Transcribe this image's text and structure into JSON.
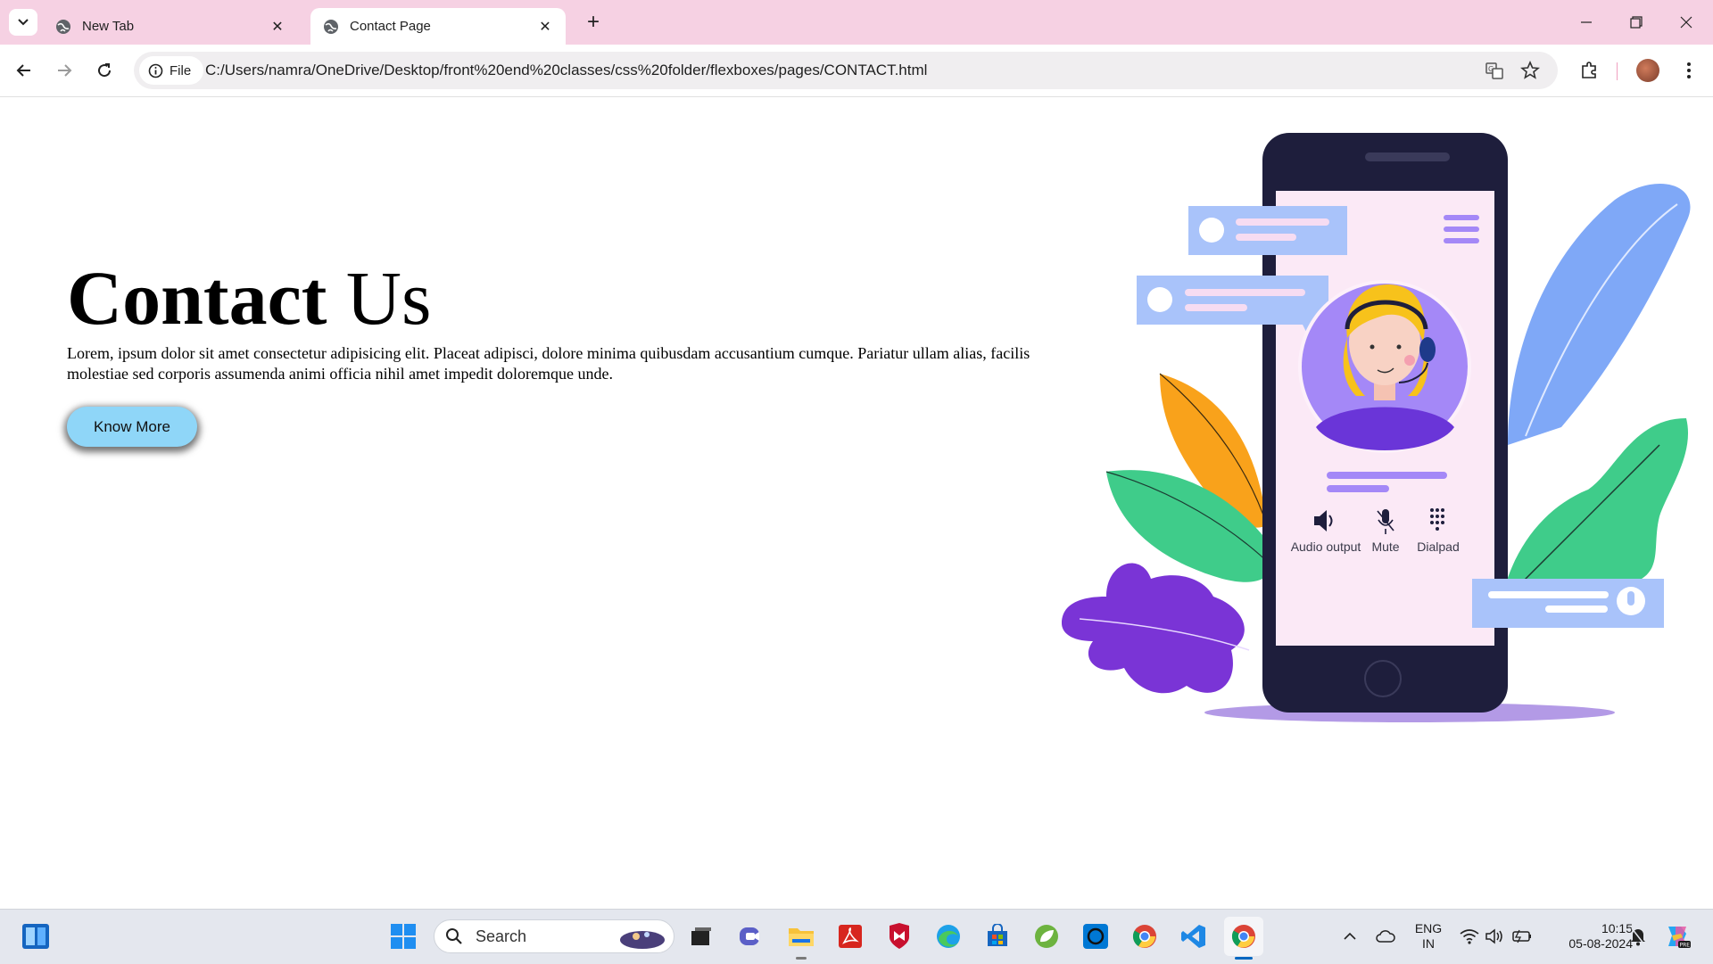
{
  "browser": {
    "tabs": [
      {
        "title": "New Tab",
        "active": false
      },
      {
        "title": "Contact Page",
        "active": true
      }
    ],
    "site_chip_label": "File",
    "url": "C:/Users/namra/OneDrive/Desktop/front%20end%20classes/css%20folder/flexboxes/pages/CONTACT.html"
  },
  "page": {
    "heading_bold": "Contact",
    "heading_rest": " Us",
    "paragraph": "Lorem, ipsum dolor sit amet consectetur adipisicing elit. Placeat adipisci, dolore minima quibusdam accusantium cumque. Pariatur ullam alias, facilis molestiae sed corporis assumenda animi officia nihil amet impedit doloremque unde.",
    "button_label": "Know More",
    "illustration": {
      "controls": [
        "Audio output",
        "Mute",
        "Dialpad"
      ],
      "colors": {
        "phone": "#1e1e3c",
        "screen": "#fbe9f6",
        "bubble": "#a9c3fa",
        "avatar_bg": "#a488f7"
      }
    }
  },
  "taskbar": {
    "search_placeholder": "Search",
    "language_line1": "ENG",
    "language_line2": "IN",
    "time": "10:15",
    "date": "05-08-2024"
  }
}
